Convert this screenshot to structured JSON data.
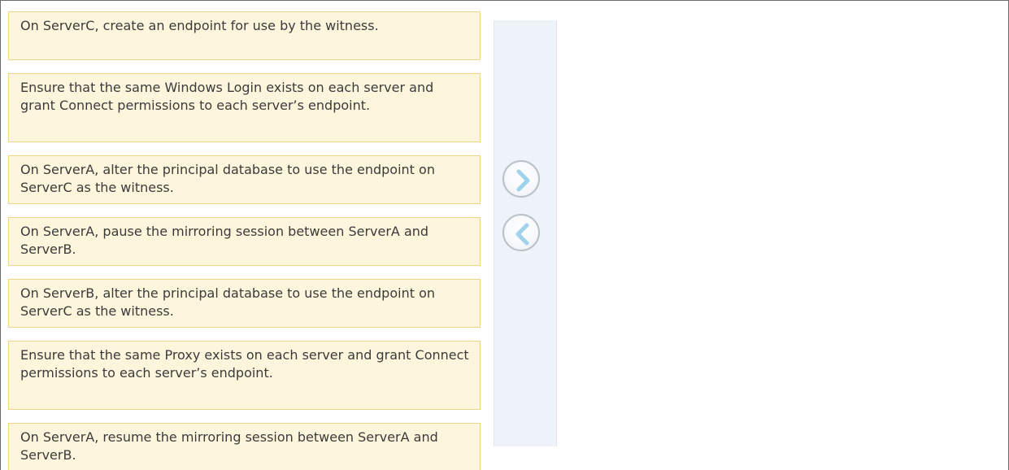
{
  "actions": [
    {
      "text": "On ServerC, create an endpoint for use by the witness."
    },
    {
      "text": "Ensure that the same Windows Login exists on each server and grant Connect permissions to each server’s endpoint."
    },
    {
      "text": "On ServerA, alter the principal database to use the endpoint on ServerC as the witness."
    },
    {
      "text": "On ServerA, pause the mirroring session between ServerA and ServerB."
    },
    {
      "text": "On ServerB, alter the principal database to use the endpoint on ServerC as the witness."
    },
    {
      "text": "Ensure that the same Proxy exists on each server and grant Connect permissions to each server’s endpoint."
    },
    {
      "text": "On ServerA, resume the mirroring session between ServerA and ServerB."
    }
  ],
  "controls": {
    "move_right_icon": "chevron-right-icon",
    "move_left_icon": "chevron-left-icon",
    "arrow_color": "#9fd2ec",
    "arrow_border_color": "#b9c0c8"
  },
  "answer_area": {
    "items": []
  }
}
